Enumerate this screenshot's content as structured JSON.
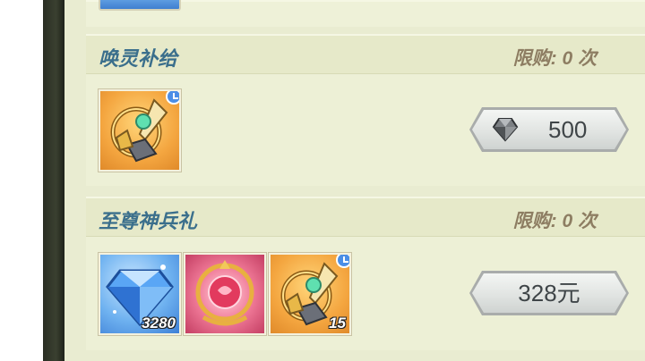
{
  "colors": {
    "title": "#3b6f8c",
    "limit": "#8d7d62",
    "panel": "#e9ecd1"
  },
  "sections": [
    {
      "title": "唤灵补给",
      "limit": "限购: 0 次",
      "items": [
        {
          "icon": "golden-compass-icon",
          "quantity": "",
          "timed": true
        }
      ],
      "price": {
        "currency_icon": "diamond-gem-icon",
        "value": "500"
      }
    },
    {
      "title": "至尊神兵礼",
      "limit": "限购: 0 次",
      "items": [
        {
          "icon": "blue-diamond-icon",
          "quantity": "3280",
          "timed": false
        },
        {
          "icon": "pink-orb-emblem-icon",
          "quantity": "",
          "timed": false
        },
        {
          "icon": "golden-compass-icon",
          "quantity": "15",
          "timed": true
        }
      ],
      "price": {
        "value": "328元"
      }
    }
  ]
}
